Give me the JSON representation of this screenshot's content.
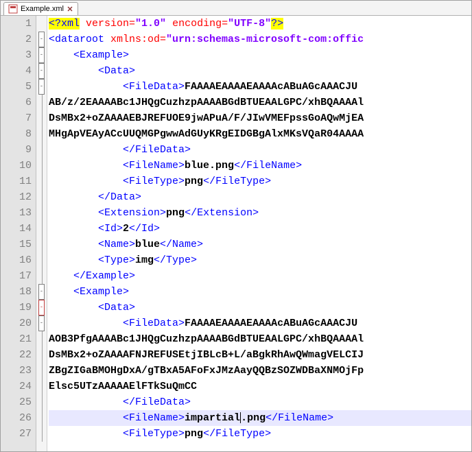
{
  "tab": {
    "filename": "Example.xml",
    "icon_name": "xml-file-icon"
  },
  "gutter": {
    "start": 1,
    "end": 27
  },
  "fold_markers": [
    {
      "line": 1,
      "type": "none"
    },
    {
      "line": 2,
      "type": "minus"
    },
    {
      "line": 3,
      "type": "minus"
    },
    {
      "line": 4,
      "type": "minus"
    },
    {
      "line": 5,
      "type": "minus"
    },
    {
      "line": 6,
      "type": "line"
    },
    {
      "line": 7,
      "type": "line"
    },
    {
      "line": 8,
      "type": "line"
    },
    {
      "line": 9,
      "type": "line"
    },
    {
      "line": 10,
      "type": "line"
    },
    {
      "line": 11,
      "type": "line"
    },
    {
      "line": 12,
      "type": "line"
    },
    {
      "line": 13,
      "type": "line"
    },
    {
      "line": 14,
      "type": "line"
    },
    {
      "line": 15,
      "type": "line"
    },
    {
      "line": 16,
      "type": "line"
    },
    {
      "line": 17,
      "type": "line"
    },
    {
      "line": 18,
      "type": "minus"
    },
    {
      "line": 19,
      "type": "minus-red"
    },
    {
      "line": 20,
      "type": "minus"
    },
    {
      "line": 21,
      "type": "line"
    },
    {
      "line": 22,
      "type": "line"
    },
    {
      "line": 23,
      "type": "line"
    },
    {
      "line": 24,
      "type": "line"
    },
    {
      "line": 25,
      "type": "line"
    },
    {
      "line": 26,
      "type": "line"
    },
    {
      "line": 27,
      "type": "line"
    }
  ],
  "xml": {
    "decl": {
      "version": "1.0",
      "encoding": "UTF-8"
    },
    "root": {
      "tag": "dataroot",
      "attr_name": "xmlns:od",
      "attr_val": "urn:schemas-microsoft-com:offic"
    },
    "ex1": {
      "filedata_lines": [
        "FAAAAEAAAAEAAAAcABuAGcAAACJU",
        "AB/z/2EAAAABc1JHQgCuzhzpAAAABGdBTUEAALGPC/xhBQAAAAl",
        "DsMBx2+oZAAAAEBJREFUOE9jwAPuA/F/JIwVMEFpssGoAQwMjEA",
        "MHgApVEAyACcUUQMGPgwwAdGUyKRgEIDGBgAlxMKsVQaR04AAAA"
      ],
      "filename": "blue.png",
      "filetype": "png",
      "extension": "png",
      "id": "2",
      "name": "blue",
      "type": "img"
    },
    "ex2": {
      "filedata_lines": [
        "FAAAAEAAAAEAAAAcABuAGcAAACJU",
        "AOB3PfgAAAABc1JHQgCuzhzpAAAABGdBTUEAALGPC/xhBQAAAAl",
        "DsMBx2+oZAAAAFNJREFUSEtjIBLcB+L/aBgkRhAwQWmagVELCIJ",
        "ZBgZIGaBMOHgDxA/gTBxA5AFoFxJMzAayQQBzSOZWDBaXNMOjFp",
        "Elsc5UTzAAAAAElFTkSuQmCC"
      ],
      "filename_parts": {
        "before": "impartial",
        "after": ".png"
      },
      "filetype": "png"
    }
  },
  "current_line": 26
}
